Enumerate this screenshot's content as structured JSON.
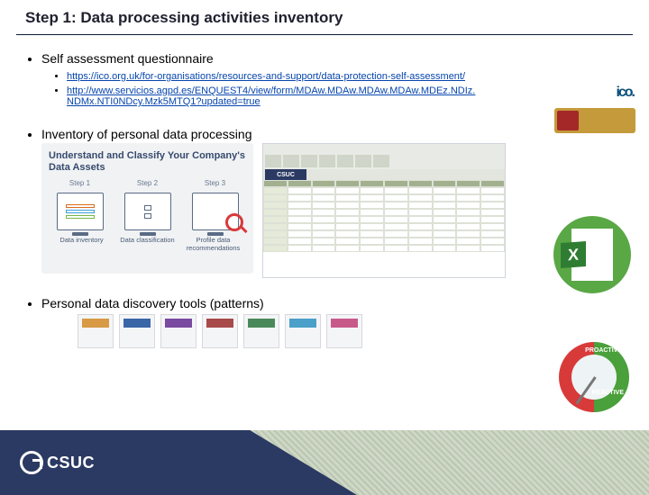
{
  "title": "Step 1: Data processing activities inventory",
  "bullets": {
    "self_assessment": "Self assessment questionnaire",
    "links": [
      "https://ico.org.uk/for-organisations/resources-and-support/data-protection-self-assessment/",
      "http://www.servicios.agpd.es/ENQUEST4/view/form/MDAw.MDAw.MDAw.MDAw.MDEz.NDIz.NDMx.NTI0NDcy.Mzk5MTQ1?updated=true"
    ],
    "inventory": "Inventory of personal data processing",
    "discovery": "Personal data discovery tools (patterns)"
  },
  "classify": {
    "heading": "Understand and Classify Your Company's Data Assets",
    "step_labels": [
      "Step 1",
      "Step 2",
      "Step 3"
    ],
    "captions": [
      "Data inventory",
      "Data classification",
      "Profile data recommendations"
    ]
  },
  "excel": {
    "letter": "X"
  },
  "dial": {
    "proactive": "PROACTIVE",
    "reactive": "REACTIVE"
  },
  "badges": {
    "ico": "ico."
  },
  "footer": {
    "brand": "CSUC"
  }
}
